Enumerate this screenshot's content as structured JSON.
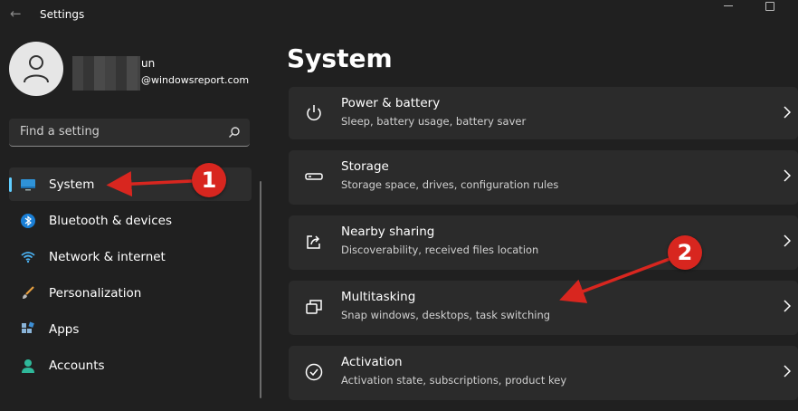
{
  "window": {
    "title": "Settings"
  },
  "user": {
    "name_fragment": "un",
    "email_fragment": "@windowsreport.com"
  },
  "search": {
    "placeholder": "Find a setting"
  },
  "nav": {
    "items": [
      {
        "label": "System",
        "icon": "monitor-icon",
        "active": true
      },
      {
        "label": "Bluetooth & devices",
        "icon": "bluetooth-icon"
      },
      {
        "label": "Network & internet",
        "icon": "wifi-icon"
      },
      {
        "label": "Personalization",
        "icon": "brush-icon"
      },
      {
        "label": "Apps",
        "icon": "apps-icon"
      },
      {
        "label": "Accounts",
        "icon": "person-icon"
      }
    ]
  },
  "page": {
    "title": "System"
  },
  "cards": [
    {
      "title": "Power & battery",
      "subtitle": "Sleep, battery usage, battery saver",
      "icon": "power-icon"
    },
    {
      "title": "Storage",
      "subtitle": "Storage space, drives, configuration rules",
      "icon": "storage-icon"
    },
    {
      "title": "Nearby sharing",
      "subtitle": "Discoverability, received files location",
      "icon": "share-icon"
    },
    {
      "title": "Multitasking",
      "subtitle": "Snap windows, desktops, task switching",
      "icon": "multitasking-icon"
    },
    {
      "title": "Activation",
      "subtitle": "Activation state, subscriptions, product key",
      "icon": "activation-check-icon"
    }
  ],
  "annotations": {
    "badge1": "1",
    "badge2": "2",
    "color": "#d8261f"
  },
  "colors": {
    "accent": "#60cdff",
    "background": "#202020",
    "card": "#2b2b2b"
  }
}
